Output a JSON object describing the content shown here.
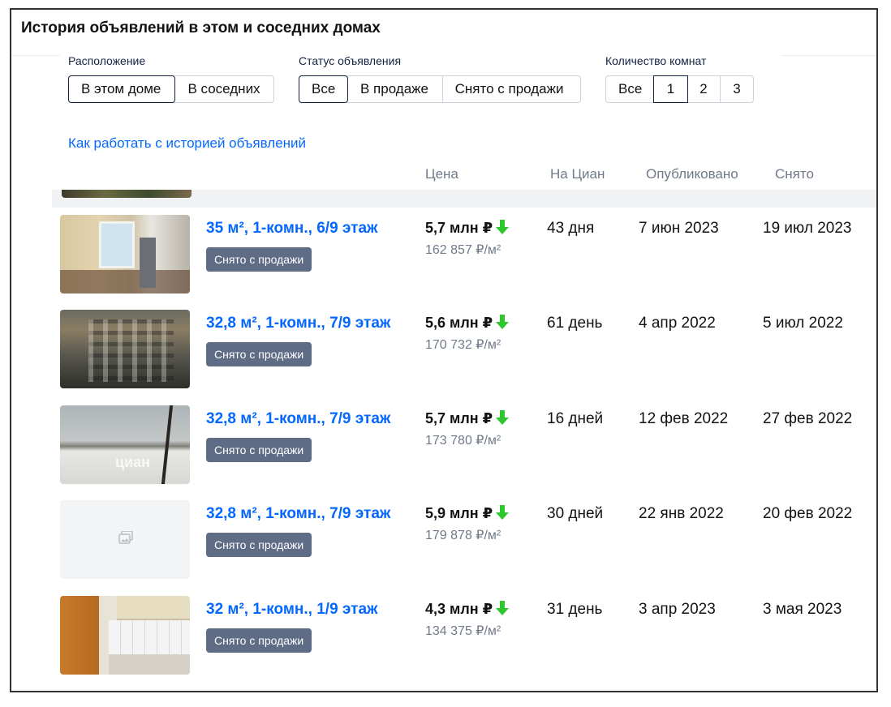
{
  "title": "История объявлений в этом и соседних домах",
  "filters": {
    "location": {
      "label": "Расположение",
      "options": [
        "В этом доме",
        "В соседних"
      ],
      "selected": "В этом доме"
    },
    "status": {
      "label": "Статус объявления",
      "options": [
        "Все",
        "В продаже",
        "Снято с продажи"
      ],
      "selected": "Все"
    },
    "rooms": {
      "label": "Количество комнат",
      "options": [
        "Все",
        "1",
        "2",
        "3"
      ],
      "selected": "1"
    }
  },
  "howto_link": "Как работать с историей объявлений",
  "columns": {
    "price": "Цена",
    "on_cian": "На Циан",
    "published": "Опубликовано",
    "removed": "Снято"
  },
  "listings": [
    {
      "title": "35 м², 1-комн., 6/9 этаж",
      "badge": "Снято с продажи",
      "price": "5,7 млн ₽",
      "price_per_m2": "162 857 ₽/м²",
      "price_trend": "down",
      "days_on_cian": "43 дня",
      "published": "7 июн 2023",
      "removed": "19 июл 2023",
      "photo": "kitchen-photo"
    },
    {
      "title": "32,8 м², 1-комн., 7/9 этаж",
      "badge": "Снято с продажи",
      "price": "5,6 млн ₽",
      "price_per_m2": "170 732 ₽/м²",
      "price_trend": "down",
      "days_on_cian": "61 день",
      "published": "4 апр 2022",
      "removed": "5 июл 2022",
      "photo": "building-facade-photo"
    },
    {
      "title": "32,8 м², 1-комн., 7/9 этаж",
      "badge": "Снято с продажи",
      "price": "5,7 млн ₽",
      "price_per_m2": "173 780 ₽/м²",
      "price_trend": "down",
      "days_on_cian": "16 дней",
      "published": "12 фев 2022",
      "removed": "27 фев 2022",
      "photo": "winter-view-photo",
      "watermark": "циан"
    },
    {
      "title": "32,8 м², 1-комн., 7/9 этаж",
      "badge": "Снято с продажи",
      "price": "5,9 млн ₽",
      "price_per_m2": "179 878 ₽/м²",
      "price_trend": "down",
      "days_on_cian": "30 дней",
      "published": "22 янв 2022",
      "removed": "20 фев 2022",
      "photo": "no-photo-placeholder"
    },
    {
      "title": "32 м², 1-комн., 1/9 этаж",
      "badge": "Снято с продажи",
      "price": "4,3 млн ₽",
      "price_per_m2": "134 375 ₽/м²",
      "price_trend": "down",
      "days_on_cian": "31 день",
      "published": "3 апр 2023",
      "removed": "3 мая 2023",
      "photo": "kitchen-photo"
    }
  ],
  "colors": {
    "link": "#0468ff",
    "badge_bg": "#5f6c85",
    "price_down": "#2ec82e",
    "muted_text": "#707a89"
  }
}
